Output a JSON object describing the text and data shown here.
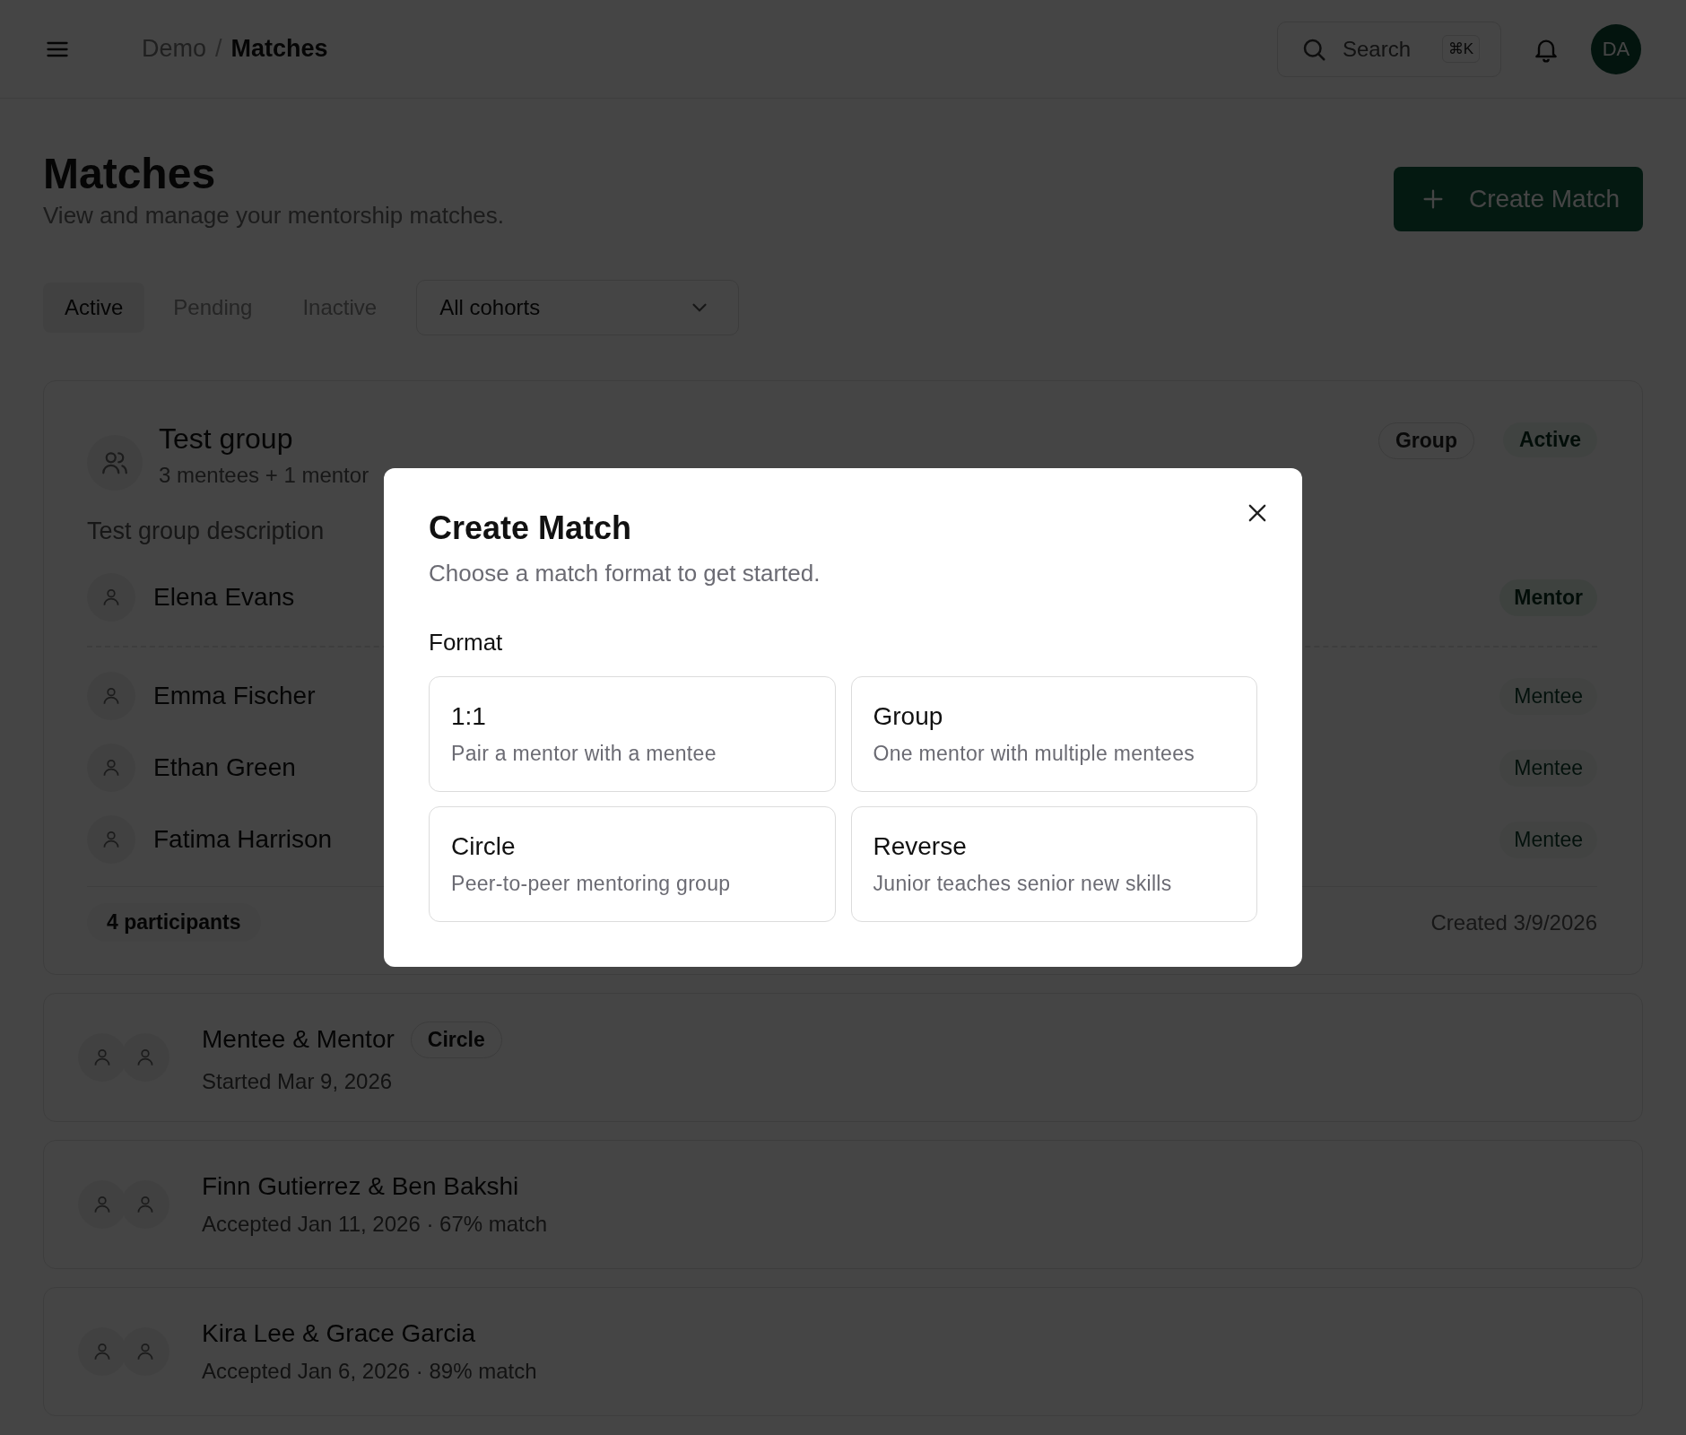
{
  "top_bar": {
    "separator": "/",
    "breadcrumb": [
      {
        "label": "Demo",
        "current": false
      },
      {
        "label": "Matches",
        "current": true
      }
    ],
    "search": {
      "placeholder": "Search",
      "shortcut": "⌘K"
    },
    "avatar": "DA"
  },
  "header": {
    "title": "Matches",
    "subtitle": "View and manage your mentorship matches.",
    "create_button": "Create Match"
  },
  "tabs": [
    {
      "label": "Active",
      "selected": true
    },
    {
      "label": "Pending",
      "selected": false
    },
    {
      "label": "Inactive",
      "selected": false
    }
  ],
  "cohort_select": {
    "value": "All cohorts"
  },
  "group_card": {
    "title": "Test group",
    "summary": "3 mentees + 1 mentor",
    "badges": [
      {
        "label": "Group",
        "kind": "outline"
      },
      {
        "label": "Active",
        "kind": "status"
      }
    ],
    "description": "Test group description",
    "members": [
      {
        "name": "Elena Evans",
        "role": "Mentor",
        "kind": "mentor"
      },
      {
        "name": "Emma Fischer",
        "role": "Mentee",
        "kind": "mentee"
      },
      {
        "name": "Ethan Green",
        "role": "Mentee",
        "kind": "mentee"
      },
      {
        "name": "Fatima Harrison",
        "role": "Mentee",
        "kind": "mentee"
      }
    ],
    "participants": "4 participants",
    "created": "Created 3/9/2026"
  },
  "matches": [
    {
      "title": "Mentee & Mentor",
      "badge": "Circle",
      "detail": "Started Mar 9, 2026"
    },
    {
      "title": "Finn Gutierrez & Ben Bakshi",
      "detail": "Accepted Jan 11, 2026 · 67% match"
    },
    {
      "title": "Kira Lee & Grace Garcia",
      "detail": "Accepted Jan 6, 2026 · 89% match"
    }
  ],
  "dialog": {
    "title": "Create Match",
    "subtitle": "Choose a match format to get started.",
    "section_label": "Format",
    "options": [
      {
        "title": "1:1",
        "description": "Pair a mentor with a mentee"
      },
      {
        "title": "Group",
        "description": "One mentor with multiple mentees"
      },
      {
        "title": "Circle",
        "description": "Peer-to-peer mentoring group"
      },
      {
        "title": "Reverse",
        "description": "Junior teaches senior new skills"
      }
    ]
  }
}
